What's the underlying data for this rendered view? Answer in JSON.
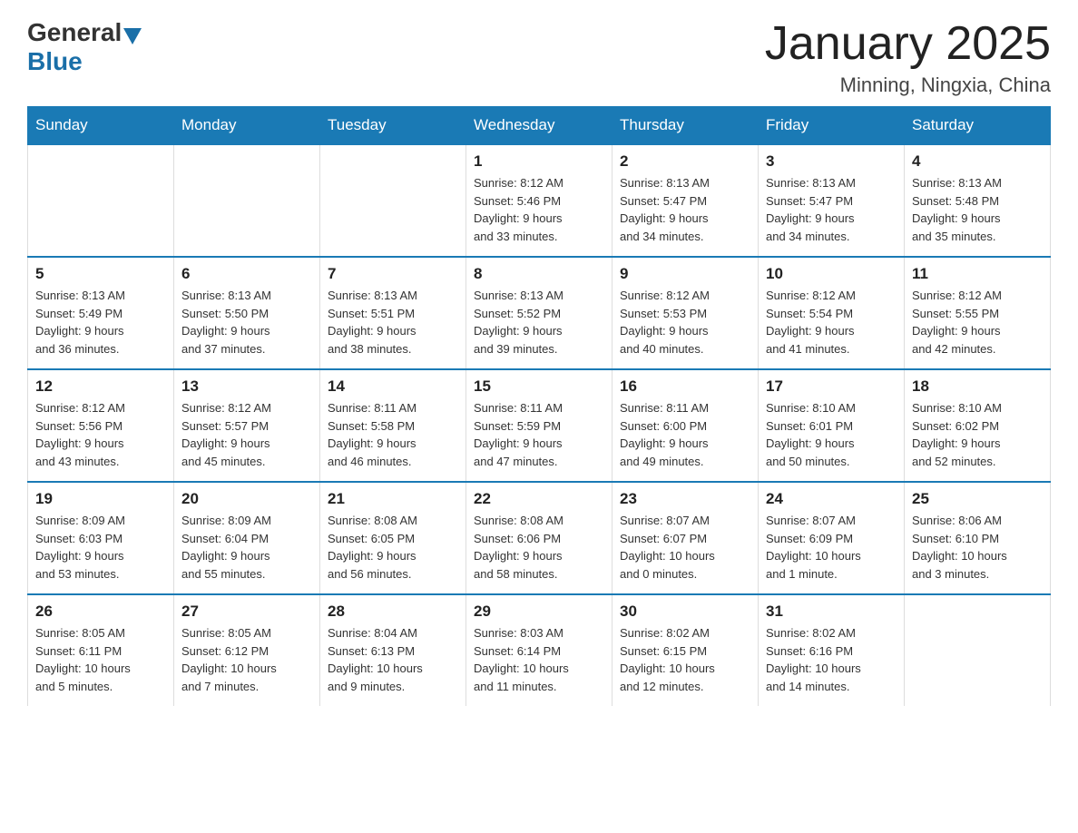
{
  "logo": {
    "general": "General",
    "blue": "Blue"
  },
  "header": {
    "title": "January 2025",
    "subtitle": "Minning, Ningxia, China"
  },
  "weekdays": [
    "Sunday",
    "Monday",
    "Tuesday",
    "Wednesday",
    "Thursday",
    "Friday",
    "Saturday"
  ],
  "weeks": [
    [
      {
        "day": "",
        "info": ""
      },
      {
        "day": "",
        "info": ""
      },
      {
        "day": "",
        "info": ""
      },
      {
        "day": "1",
        "info": "Sunrise: 8:12 AM\nSunset: 5:46 PM\nDaylight: 9 hours\nand 33 minutes."
      },
      {
        "day": "2",
        "info": "Sunrise: 8:13 AM\nSunset: 5:47 PM\nDaylight: 9 hours\nand 34 minutes."
      },
      {
        "day": "3",
        "info": "Sunrise: 8:13 AM\nSunset: 5:47 PM\nDaylight: 9 hours\nand 34 minutes."
      },
      {
        "day": "4",
        "info": "Sunrise: 8:13 AM\nSunset: 5:48 PM\nDaylight: 9 hours\nand 35 minutes."
      }
    ],
    [
      {
        "day": "5",
        "info": "Sunrise: 8:13 AM\nSunset: 5:49 PM\nDaylight: 9 hours\nand 36 minutes."
      },
      {
        "day": "6",
        "info": "Sunrise: 8:13 AM\nSunset: 5:50 PM\nDaylight: 9 hours\nand 37 minutes."
      },
      {
        "day": "7",
        "info": "Sunrise: 8:13 AM\nSunset: 5:51 PM\nDaylight: 9 hours\nand 38 minutes."
      },
      {
        "day": "8",
        "info": "Sunrise: 8:13 AM\nSunset: 5:52 PM\nDaylight: 9 hours\nand 39 minutes."
      },
      {
        "day": "9",
        "info": "Sunrise: 8:12 AM\nSunset: 5:53 PM\nDaylight: 9 hours\nand 40 minutes."
      },
      {
        "day": "10",
        "info": "Sunrise: 8:12 AM\nSunset: 5:54 PM\nDaylight: 9 hours\nand 41 minutes."
      },
      {
        "day": "11",
        "info": "Sunrise: 8:12 AM\nSunset: 5:55 PM\nDaylight: 9 hours\nand 42 minutes."
      }
    ],
    [
      {
        "day": "12",
        "info": "Sunrise: 8:12 AM\nSunset: 5:56 PM\nDaylight: 9 hours\nand 43 minutes."
      },
      {
        "day": "13",
        "info": "Sunrise: 8:12 AM\nSunset: 5:57 PM\nDaylight: 9 hours\nand 45 minutes."
      },
      {
        "day": "14",
        "info": "Sunrise: 8:11 AM\nSunset: 5:58 PM\nDaylight: 9 hours\nand 46 minutes."
      },
      {
        "day": "15",
        "info": "Sunrise: 8:11 AM\nSunset: 5:59 PM\nDaylight: 9 hours\nand 47 minutes."
      },
      {
        "day": "16",
        "info": "Sunrise: 8:11 AM\nSunset: 6:00 PM\nDaylight: 9 hours\nand 49 minutes."
      },
      {
        "day": "17",
        "info": "Sunrise: 8:10 AM\nSunset: 6:01 PM\nDaylight: 9 hours\nand 50 minutes."
      },
      {
        "day": "18",
        "info": "Sunrise: 8:10 AM\nSunset: 6:02 PM\nDaylight: 9 hours\nand 52 minutes."
      }
    ],
    [
      {
        "day": "19",
        "info": "Sunrise: 8:09 AM\nSunset: 6:03 PM\nDaylight: 9 hours\nand 53 minutes."
      },
      {
        "day": "20",
        "info": "Sunrise: 8:09 AM\nSunset: 6:04 PM\nDaylight: 9 hours\nand 55 minutes."
      },
      {
        "day": "21",
        "info": "Sunrise: 8:08 AM\nSunset: 6:05 PM\nDaylight: 9 hours\nand 56 minutes."
      },
      {
        "day": "22",
        "info": "Sunrise: 8:08 AM\nSunset: 6:06 PM\nDaylight: 9 hours\nand 58 minutes."
      },
      {
        "day": "23",
        "info": "Sunrise: 8:07 AM\nSunset: 6:07 PM\nDaylight: 10 hours\nand 0 minutes."
      },
      {
        "day": "24",
        "info": "Sunrise: 8:07 AM\nSunset: 6:09 PM\nDaylight: 10 hours\nand 1 minute."
      },
      {
        "day": "25",
        "info": "Sunrise: 8:06 AM\nSunset: 6:10 PM\nDaylight: 10 hours\nand 3 minutes."
      }
    ],
    [
      {
        "day": "26",
        "info": "Sunrise: 8:05 AM\nSunset: 6:11 PM\nDaylight: 10 hours\nand 5 minutes."
      },
      {
        "day": "27",
        "info": "Sunrise: 8:05 AM\nSunset: 6:12 PM\nDaylight: 10 hours\nand 7 minutes."
      },
      {
        "day": "28",
        "info": "Sunrise: 8:04 AM\nSunset: 6:13 PM\nDaylight: 10 hours\nand 9 minutes."
      },
      {
        "day": "29",
        "info": "Sunrise: 8:03 AM\nSunset: 6:14 PM\nDaylight: 10 hours\nand 11 minutes."
      },
      {
        "day": "30",
        "info": "Sunrise: 8:02 AM\nSunset: 6:15 PM\nDaylight: 10 hours\nand 12 minutes."
      },
      {
        "day": "31",
        "info": "Sunrise: 8:02 AM\nSunset: 6:16 PM\nDaylight: 10 hours\nand 14 minutes."
      },
      {
        "day": "",
        "info": ""
      }
    ]
  ]
}
